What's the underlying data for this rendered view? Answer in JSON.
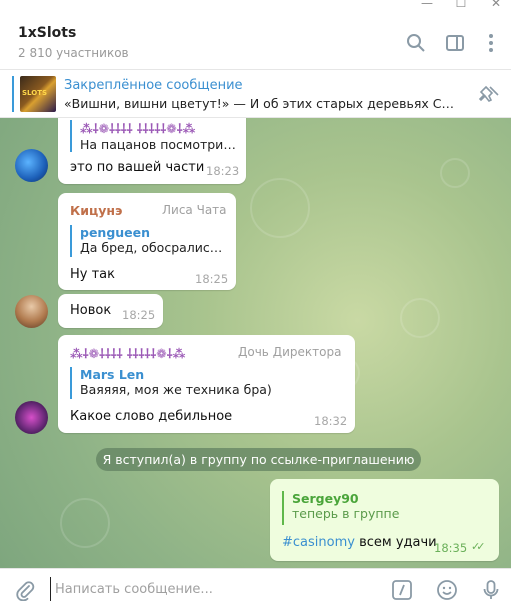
{
  "window": {
    "minimize": "—",
    "maximize": "☐",
    "close": "✕"
  },
  "header": {
    "title": "1xSlots",
    "subtitle": "2 810 участников"
  },
  "pinned": {
    "title": "Закреплённое сообщение",
    "text": "«Вишни, вишни цветут!» — И об этих старых деревьях Слоты...",
    "thumb_text": "SLOTS"
  },
  "messages": {
    "m1": {
      "reply_text": "На пацанов посмотрит...",
      "reply_name": "⁢⁡⁣⁤⁣⁡⁤",
      "text": "это по вашей части",
      "time": "18:23"
    },
    "m2": {
      "sender": "Кицунэ",
      "role": "Лиса Чата",
      "reply_name": "pengueen",
      "reply_text": "Да бред, обосрались ...",
      "text": "Ну так",
      "time": "18:25"
    },
    "m3": {
      "text": "Новок",
      "time": "18:25"
    },
    "m4": {
      "sender": "⁢⁡⁣⁤⁣⁡⁤",
      "role": "Дочь Директора",
      "reply_name": "Mars Len",
      "reply_text": "Ваяяяя, моя же техника бра)",
      "text": "Какое слово дебильное",
      "time": "18:32"
    },
    "service": "Я вступил(а) в группу по ссылке-приглашению",
    "mine": {
      "reply_name": "Sergey90",
      "reply_text": "теперь в группе",
      "hashtag": "#casinomy",
      "text": " всем удачи",
      "time": "18:35",
      "ticks": "✓✓"
    }
  },
  "composer": {
    "placeholder": "Написать сообщение..."
  },
  "colors": {
    "accent": "#3a9ad9",
    "sender_kitsune": "#c0704a",
    "sender_doch": "#9b59b6",
    "outgoing": "#effdde"
  }
}
